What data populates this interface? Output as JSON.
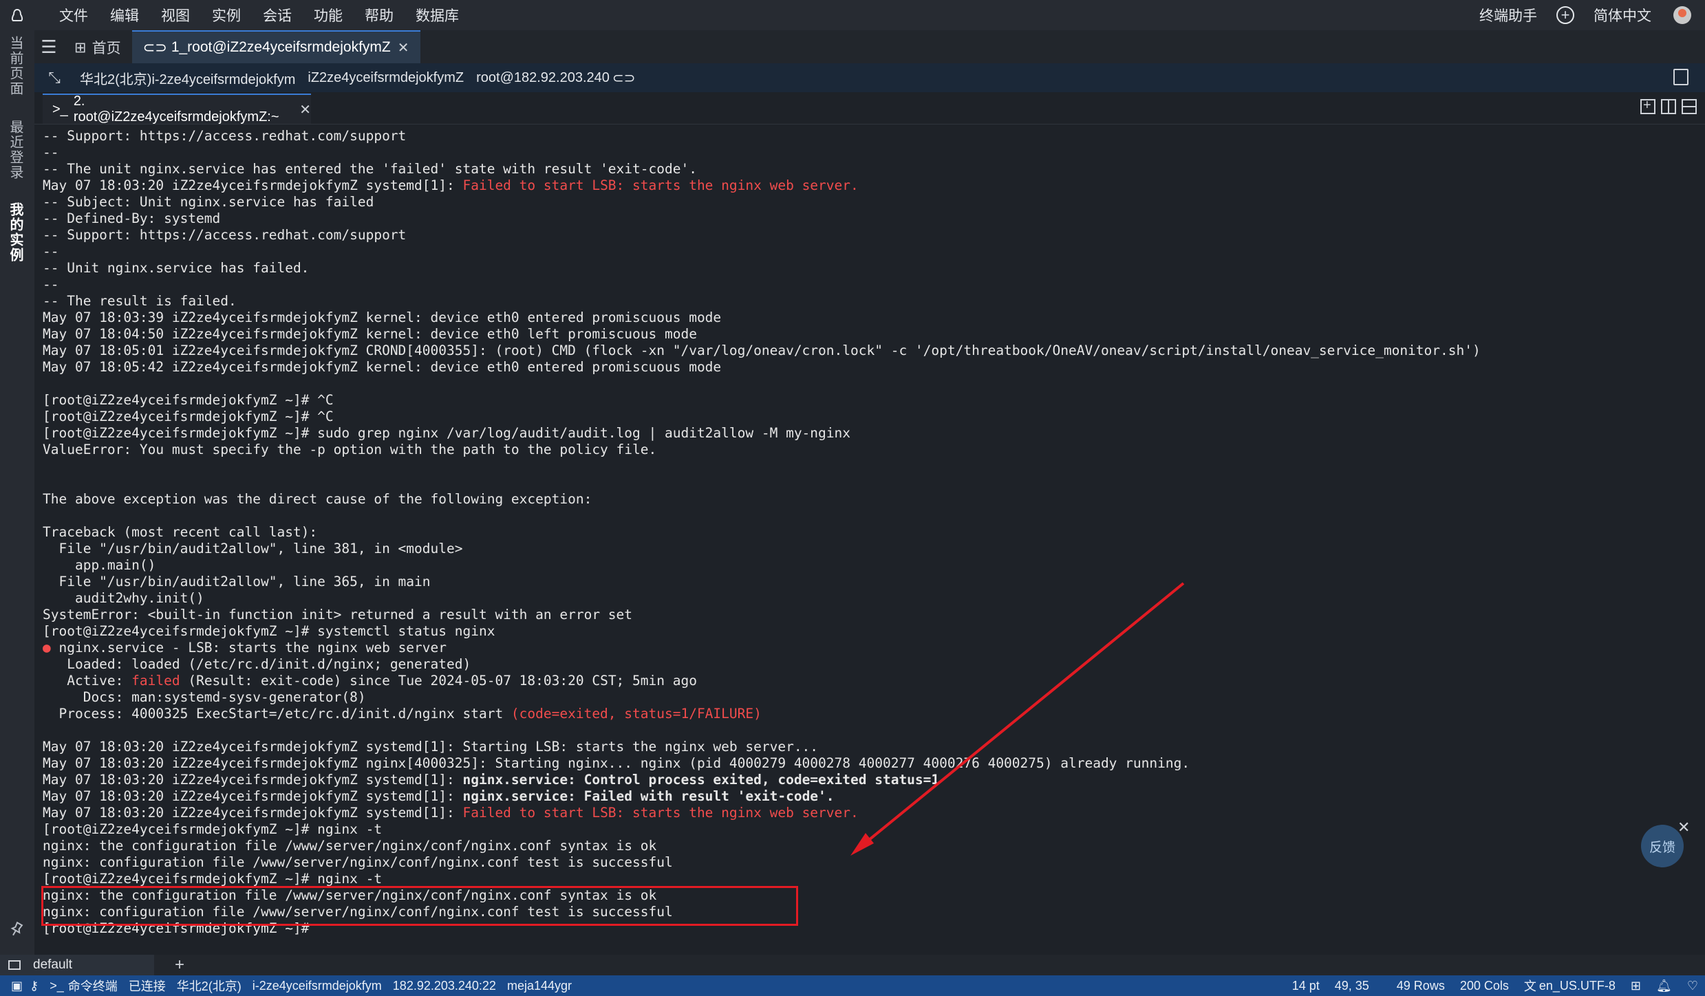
{
  "menu": {
    "items": [
      "文件",
      "编辑",
      "视图",
      "实例",
      "会话",
      "功能",
      "帮助",
      "数据库"
    ],
    "assistant": "终端助手",
    "language": "简体中文"
  },
  "sidebar": {
    "tabs": [
      "当前页面",
      "最近登录",
      "我的实例"
    ]
  },
  "tabs": {
    "home": "首页",
    "session": "1_root@iZ2ze4yceifsrmdejokfymZ"
  },
  "info": {
    "region_instance": "华北2(北京)i-2ze4yceifsrmdejokfym",
    "hostname": "iZ2ze4yceifsrmdejokfymZ",
    "address": "root@182.92.203.240"
  },
  "terminal_tab": {
    "label": "2. root@iZ2ze4yceifsrmdejokfymZ:~"
  },
  "terminal": {
    "lines": [
      [
        {
          "t": "-- Support: https://access.redhat.com/support"
        }
      ],
      [
        {
          "t": "--"
        }
      ],
      [
        {
          "t": "-- The unit nginx.service has entered the 'failed' state with result 'exit-code'."
        }
      ],
      [
        {
          "t": "May 07 18:03:20 iZ2ze4yceifsrmdejokfymZ systemd[1]: "
        },
        {
          "t": "Failed to start LSB: starts the nginx web server.",
          "c": "red"
        }
      ],
      [
        {
          "t": "-- Subject: Unit nginx.service has failed"
        }
      ],
      [
        {
          "t": "-- Defined-By: systemd"
        }
      ],
      [
        {
          "t": "-- Support: https://access.redhat.com/support"
        }
      ],
      [
        {
          "t": "--"
        }
      ],
      [
        {
          "t": "-- Unit nginx.service has failed."
        }
      ],
      [
        {
          "t": "--"
        }
      ],
      [
        {
          "t": "-- The result is failed."
        }
      ],
      [
        {
          "t": "May 07 18:03:39 iZ2ze4yceifsrmdejokfymZ kernel: device eth0 entered promiscuous mode"
        }
      ],
      [
        {
          "t": "May 07 18:04:50 iZ2ze4yceifsrmdejokfymZ kernel: device eth0 left promiscuous mode"
        }
      ],
      [
        {
          "t": "May 07 18:05:01 iZ2ze4yceifsrmdejokfymZ CROND[4000355]: (root) CMD (flock -xn \"/var/log/oneav/cron.lock\" -c '/opt/threatbook/OneAV/oneav/script/install/oneav_service_monitor.sh')"
        }
      ],
      [
        {
          "t": "May 07 18:05:42 iZ2ze4yceifsrmdejokfymZ kernel: device eth0 entered promiscuous mode"
        }
      ],
      [
        {
          "t": ""
        }
      ],
      [
        {
          "t": "[root@iZ2ze4yceifsrmdejokfymZ ~]# ^C"
        }
      ],
      [
        {
          "t": "[root@iZ2ze4yceifsrmdejokfymZ ~]# ^C"
        }
      ],
      [
        {
          "t": "[root@iZ2ze4yceifsrmdejokfymZ ~]# sudo grep nginx /var/log/audit/audit.log | audit2allow -M my-nginx"
        }
      ],
      [
        {
          "t": "ValueError: You must specify the -p option with the path to the policy file."
        }
      ],
      [
        {
          "t": ""
        }
      ],
      [
        {
          "t": ""
        }
      ],
      [
        {
          "t": "The above exception was the direct cause of the following exception:"
        }
      ],
      [
        {
          "t": ""
        }
      ],
      [
        {
          "t": "Traceback (most recent call last):"
        }
      ],
      [
        {
          "t": "  File \"/usr/bin/audit2allow\", line 381, in <module>"
        }
      ],
      [
        {
          "t": "    app.main()"
        }
      ],
      [
        {
          "t": "  File \"/usr/bin/audit2allow\", line 365, in main"
        }
      ],
      [
        {
          "t": "    audit2why.init()"
        }
      ],
      [
        {
          "t": "SystemError: <built-in function init> returned a result with an error set"
        }
      ],
      [
        {
          "t": "[root@iZ2ze4yceifsrmdejokfymZ ~]# systemctl status nginx"
        }
      ],
      [
        {
          "t": "●",
          "c": "red"
        },
        {
          "t": " nginx.service - LSB: starts the nginx web server"
        }
      ],
      [
        {
          "t": "   Loaded: loaded (/etc/rc.d/init.d/nginx; generated)"
        }
      ],
      [
        {
          "t": "   Active: "
        },
        {
          "t": "failed",
          "c": "red"
        },
        {
          "t": " (Result: exit-code) since Tue 2024-05-07 18:03:20 CST; 5min ago"
        }
      ],
      [
        {
          "t": "     Docs: man:systemd-sysv-generator(8)"
        }
      ],
      [
        {
          "t": "  Process: 4000325 ExecStart=/etc/rc.d/init.d/nginx start "
        },
        {
          "t": "(code=exited, status=1/FAILURE)",
          "c": "red"
        }
      ],
      [
        {
          "t": ""
        }
      ],
      [
        {
          "t": "May 07 18:03:20 iZ2ze4yceifsrmdejokfymZ systemd[1]: Starting LSB: starts the nginx web server..."
        }
      ],
      [
        {
          "t": "May 07 18:03:20 iZ2ze4yceifsrmdejokfymZ nginx[4000325]: Starting nginx... nginx (pid 4000279 4000278 4000277 4000276 4000275) already running."
        }
      ],
      [
        {
          "t": "May 07 18:03:20 iZ2ze4yceifsrmdejokfymZ systemd[1]: "
        },
        {
          "t": "nginx.service: Control process exited, code=exited status=1",
          "c": "bold"
        }
      ],
      [
        {
          "t": "May 07 18:03:20 iZ2ze4yceifsrmdejokfymZ systemd[1]: "
        },
        {
          "t": "nginx.service: Failed with result 'exit-code'.",
          "c": "bold"
        }
      ],
      [
        {
          "t": "May 07 18:03:20 iZ2ze4yceifsrmdejokfymZ systemd[1]: "
        },
        {
          "t": "Failed to start LSB: starts the nginx web server.",
          "c": "red"
        }
      ],
      [
        {
          "t": "[root@iZ2ze4yceifsrmdejokfymZ ~]# nginx -t"
        }
      ],
      [
        {
          "t": "nginx: the configuration file /www/server/nginx/conf/nginx.conf syntax is ok"
        }
      ],
      [
        {
          "t": "nginx: configuration file /www/server/nginx/conf/nginx.conf test is successful"
        }
      ],
      [
        {
          "t": "[root@iZ2ze4yceifsrmdejokfymZ ~]# nginx -t"
        }
      ],
      [
        {
          "t": "nginx: the configuration file /www/server/nginx/conf/nginx.conf syntax is ok"
        }
      ],
      [
        {
          "t": "nginx: configuration file /www/server/nginx/conf/nginx.conf test is successful"
        }
      ],
      [
        {
          "t": "[root@iZ2ze4yceifsrmdejokfymZ ~]# "
        }
      ]
    ]
  },
  "feedback": "反馈",
  "session_bar": {
    "name": "default"
  },
  "status": {
    "terminal_label": "命令终端",
    "connection": "已连接",
    "region": "华北2(北京)",
    "instance": "i-2ze4yceifsrmdejokfym",
    "ip_port": "182.92.203.240:22",
    "user": "meja144ygr",
    "font_size": "14 pt",
    "cursor": "49, 35",
    "rows": "49 Rows",
    "cols": "200 Cols",
    "encoding": "en_US.UTF-8"
  },
  "colors": {
    "accent": "#3a7bd5",
    "statusbar": "#1a4a8a",
    "error_red": "#f14c4c",
    "annotation_red": "#e21b23"
  }
}
